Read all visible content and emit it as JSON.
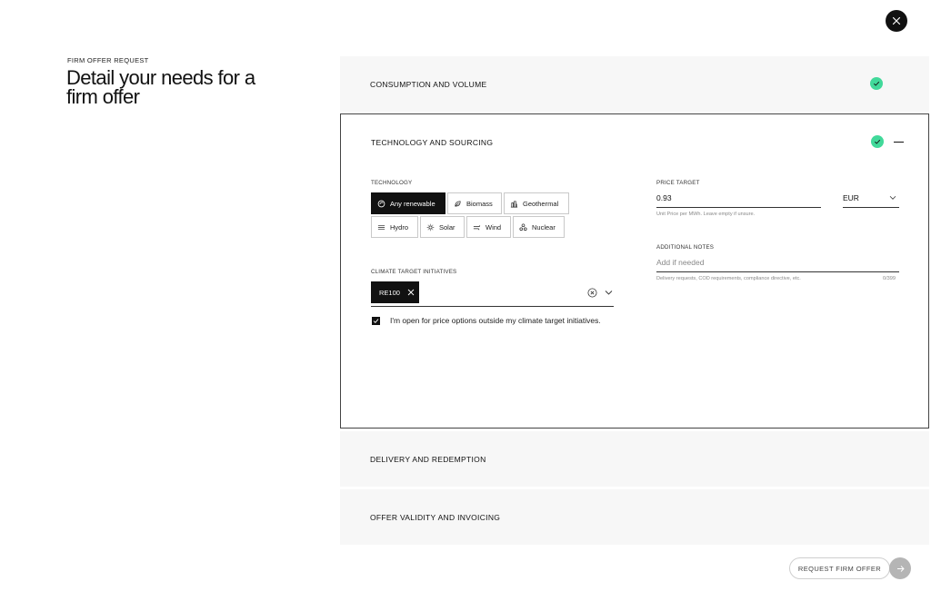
{
  "header": {
    "eyebrow": "FIRM OFFER REQUEST",
    "title": "Detail your needs for a firm offer",
    "close_icon": "close-icon"
  },
  "sections": {
    "consumption": {
      "title": "CONSUMPTION AND VOLUME",
      "completed": true
    },
    "technology": {
      "title": "TECHNOLOGY AND SOURCING",
      "completed": true,
      "expanded": true,
      "technology_label": "TECHNOLOGY",
      "technology_options": [
        {
          "label": "Any renewable",
          "icon": "renewable-icon",
          "selected": true
        },
        {
          "label": "Biomass",
          "icon": "biomass-icon",
          "selected": false
        },
        {
          "label": "Geothermal",
          "icon": "geothermal-icon",
          "selected": false
        },
        {
          "label": "Hydro",
          "icon": "hydro-icon",
          "selected": false
        },
        {
          "label": "Solar",
          "icon": "solar-icon",
          "selected": false
        },
        {
          "label": "Wind",
          "icon": "wind-icon",
          "selected": false
        },
        {
          "label": "Nuclear",
          "icon": "nuclear-icon",
          "selected": false
        }
      ],
      "climate_label": "CLIMATE TARGET INITIATIVES",
      "climate_selected": [
        "RE100"
      ],
      "open_options_checked": true,
      "open_options_label": "I'm open for price options outside my climate target initiatives.",
      "price_label": "PRICE TARGET",
      "price_value": "0.93",
      "price_helper": "Unit Price per MWh. Leave empty if unsure.",
      "currency": "EUR",
      "notes_label": "ADDITIONAL NOTES",
      "notes_placeholder": "Add if needed",
      "notes_helper": "Delivery requests, COD requirements, compliance directive, etc.",
      "notes_counter": "0/399"
    },
    "delivery": {
      "title": "DELIVERY AND REDEMPTION"
    },
    "validity": {
      "title": "OFFER VALIDITY AND INVOICING"
    }
  },
  "footer": {
    "submit_label": "REQUEST FIRM OFFER",
    "next_icon": "arrow-right-icon"
  },
  "colors": {
    "accent_check": "#41d99a",
    "primary": "#111111",
    "section_bg": "#f7f7f7"
  }
}
